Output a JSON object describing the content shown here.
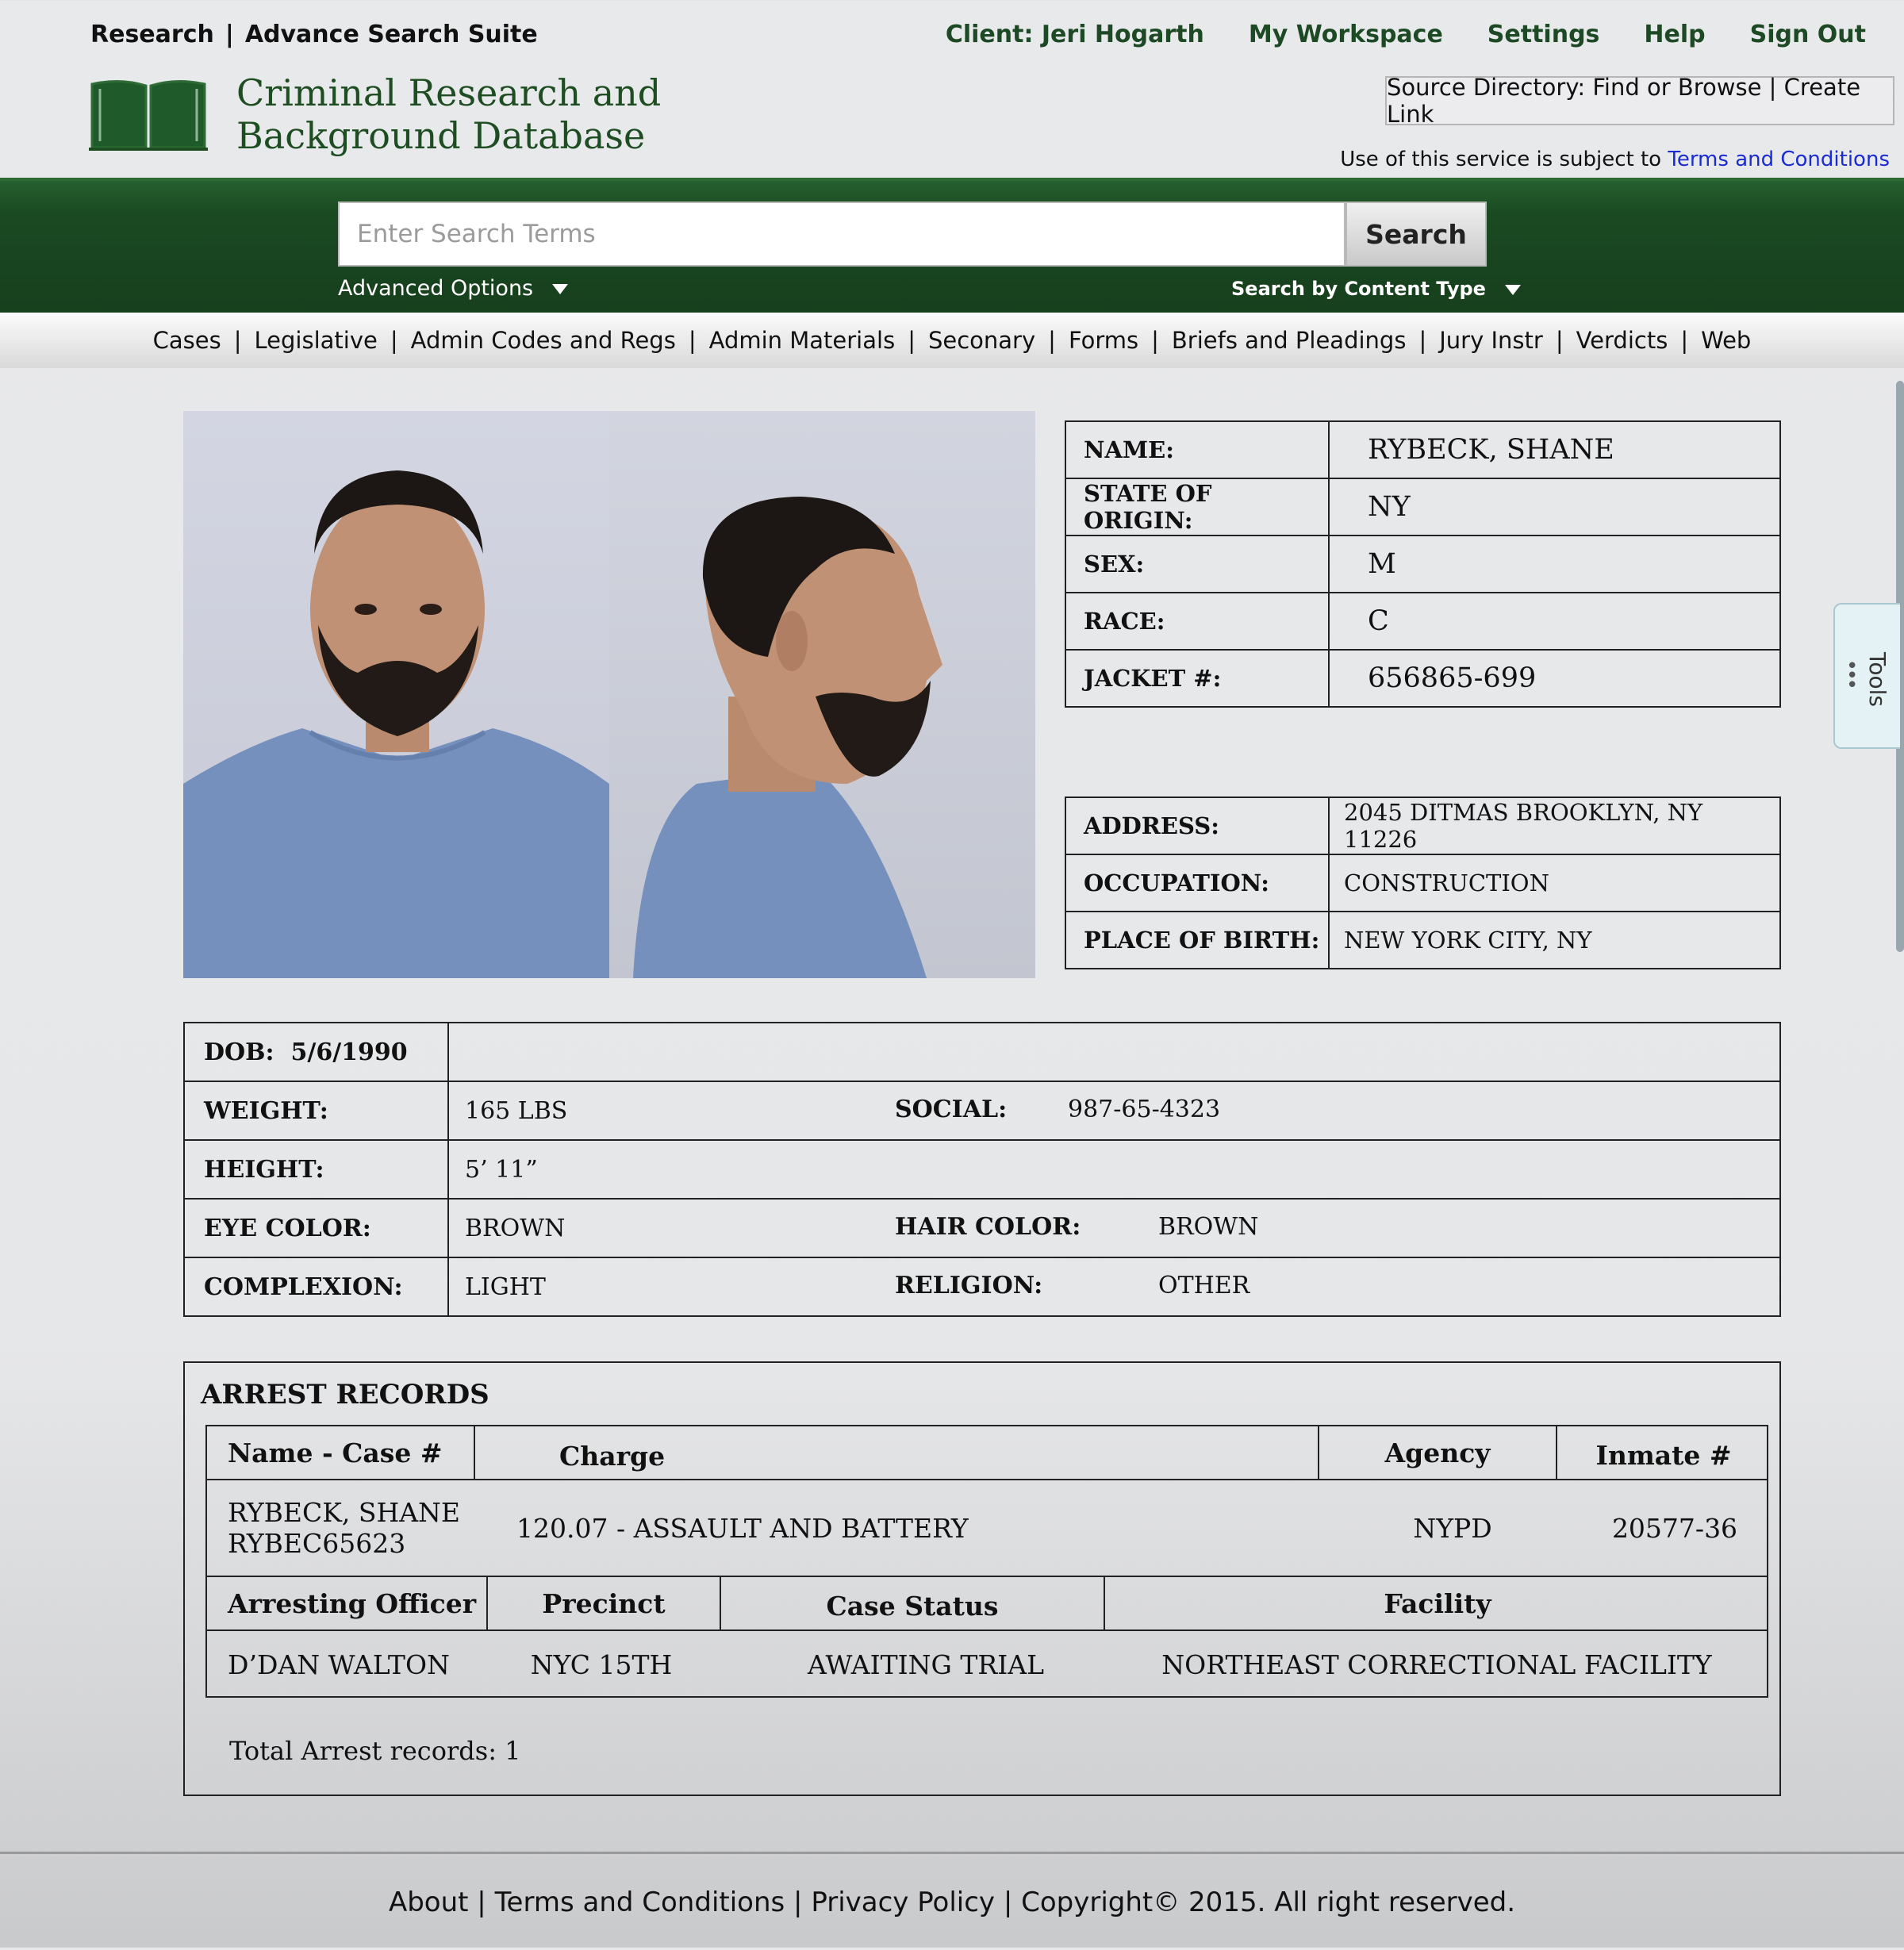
{
  "header": {
    "research": "Research",
    "suite": "Advance Search Suite",
    "nav": [
      "Client: Jeri Hogarth",
      "My Workspace",
      "Settings",
      "Help",
      "Sign Out"
    ],
    "brand_line1": "Criminal Research and",
    "brand_line2": "Background Database",
    "source_directory": "Source Directory: Find or Browse | Create Link",
    "terms_prefix": "Use of this service is subject to",
    "terms_link": "Terms and Conditions"
  },
  "search": {
    "placeholder": "Enter Search Terms",
    "button": "Search",
    "advanced": "Advanced Options",
    "by_type": "Search by Content Type"
  },
  "categories": [
    "Cases",
    "Legislative",
    "Admin Codes and Regs",
    "Admin Materials",
    "Seconary",
    "Forms",
    "Briefs and Pleadings",
    "Jury Instr",
    "Verdicts",
    "Web"
  ],
  "tools_label": "Tools",
  "identity": [
    {
      "label": "NAME:",
      "value": "RYBECK, SHANE"
    },
    {
      "label": "STATE OF ORIGIN:",
      "value": "NY"
    },
    {
      "label": "SEX:",
      "value": "M"
    },
    {
      "label": "RACE:",
      "value": "C"
    },
    {
      "label": "JACKET #:",
      "value": "656865-699"
    }
  ],
  "address": [
    {
      "label": "ADDRESS:",
      "value": "2045 DITMAS BROOKLYN, NY 11226"
    },
    {
      "label": "OCCUPATION:",
      "value": "CONSTRUCTION"
    },
    {
      "label": "PLACE OF BIRTH:",
      "value": "NEW YORK CITY, NY"
    }
  ],
  "physical": {
    "dob_label": "DOB:",
    "dob": "5/6/1990",
    "weight_label": "WEIGHT:",
    "weight": "165 LBS",
    "social_label": "SOCIAL:",
    "social": "987-65-4323",
    "height_label": "HEIGHT:",
    "height": "5’ 11”",
    "eye_label": "EYE COLOR:",
    "eye": "BROWN",
    "hair_label": "HAIR COLOR:",
    "hair": "BROWN",
    "complexion_label": "COMPLEXION:",
    "complexion": "LIGHT",
    "religion_label": "RELIGION:",
    "religion": "OTHER"
  },
  "arrest": {
    "title": "ARREST RECORDS",
    "headers1": [
      "Name - Case #",
      "Charge",
      "Agency",
      "Inmate #"
    ],
    "row1": {
      "name": "RYBECK, SHANE",
      "case": "RYBEC65623",
      "charge": "120.07 - ASSAULT AND BATTERY",
      "agency": "NYPD",
      "inmate": "20577-36"
    },
    "headers2": [
      "Arresting Officer",
      "Precinct",
      "Case Status",
      "Facility"
    ],
    "row2": {
      "officer": "D’DAN WALTON",
      "precinct": "NYC 15TH",
      "status": "AWAITING TRIAL",
      "facility": "NORTHEAST CORRECTIONAL FACILITY"
    },
    "total": "Total Arrest records: 1"
  },
  "footer": [
    "About",
    "Terms and Conditions",
    "Privacy Policy",
    "Copyright© 2015. All right reserved."
  ],
  "colors": {
    "brand_green": "#1a4a22",
    "link_blue": "#1a2bd1"
  }
}
